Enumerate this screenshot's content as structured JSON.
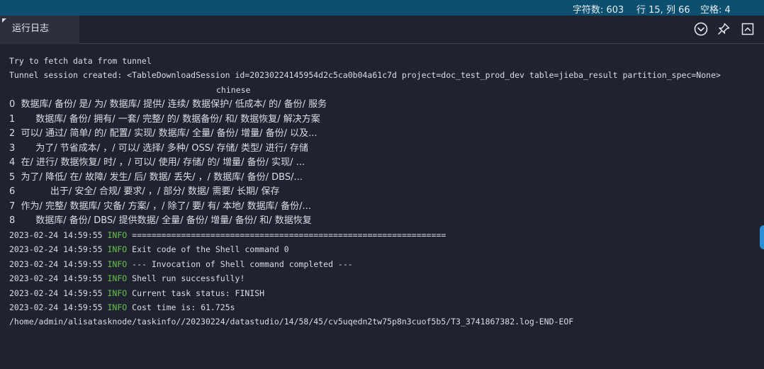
{
  "status_bar": {
    "char_count": "字符数: 603",
    "cursor_position": "行 15, 列 66",
    "indent": "空格: 4"
  },
  "panel": {
    "tab_label": "运行日志",
    "icons": [
      "chevron-down-circle-icon",
      "pin-icon",
      "maximize-icon"
    ]
  },
  "log": {
    "lines": [
      "Try to fetch data from tunnel",
      "Tunnel session created: <TableDownloadSession id=20230224145954d2c5ca0b04a61c7d project=doc_test_prod_dev table=jieba_result partition_spec=None>",
      "chinese",
      "0  数据库/ 备份/ 是/ 为/ 数据库/ 提供/ 连续/ 数据保护/ 低成本/ 的/ 备份/ 服务",
      "1       数据库/ 备份/ 拥有/ 一套/ 完整/ 的/ 数据备份/ 和/ 数据恢复/ 解决方案",
      "2  可以/ 通过/ 简单/ 的/ 配置/ 实现/ 数据库/ 全量/ 备份/ 增量/ 备份/ 以及...",
      "3       为了/ 节省成本/ ，/ 可以/ 选择/ 多种/ OSS/ 存储/ 类型/ 进行/ 存储",
      "4  在/ 进行/ 数据恢复/ 时/ ，/ 可以/ 使用/ 存储/ 的/ 增量/ 备份/ 实现/ ...",
      "5  为了/ 降低/ 在/ 故障/ 发生/ 后/ 数据/ 丢失/ ，/ 数据库/ 备份/ DBS/...",
      "6            出于/ 安全/ 合规/ 要求/ ，/ 部分/ 数据/ 需要/ 长期/ 保存",
      "7  作为/ 完整/ 数据库/ 灾备/ 方案/ ，/ 除了/ 要/ 有/ 本地/ 数据库/ 备份/...",
      "8       数据库/ 备份/ DBS/ 提供数据/ 全量/ 备份/ 增量/ 备份/ 和/ 数据恢复"
    ],
    "entries": [
      {
        "timestamp": "2023-02-24 14:59:55",
        "level": "INFO",
        "message": "================================================================"
      },
      {
        "timestamp": "2023-02-24 14:59:55",
        "level": "INFO",
        "message": "Exit code of the Shell command 0"
      },
      {
        "timestamp": "2023-02-24 14:59:55",
        "level": "INFO",
        "message": "--- Invocation of Shell command completed ---"
      },
      {
        "timestamp": "2023-02-24 14:59:55",
        "level": "INFO",
        "message": "Shell run successfully!"
      },
      {
        "timestamp": "2023-02-24 14:59:55",
        "level": "INFO",
        "message": "Current task status: FINISH"
      },
      {
        "timestamp": "2023-02-24 14:59:55",
        "level": "INFO",
        "message": "Cost time is: 61.725s"
      }
    ],
    "footer_path": "/home/admin/alisatasknode/taskinfo//20230224/datastudio/14/58/45/cv5uqedn2tw75p8n3cuof5b5/T3_3741867382.log-END-EOF"
  },
  "colors": {
    "status_bar_bg": "#0c4f6e",
    "background": "#1f232f",
    "text": "#dadde3",
    "info_level": "#6abf4b"
  }
}
